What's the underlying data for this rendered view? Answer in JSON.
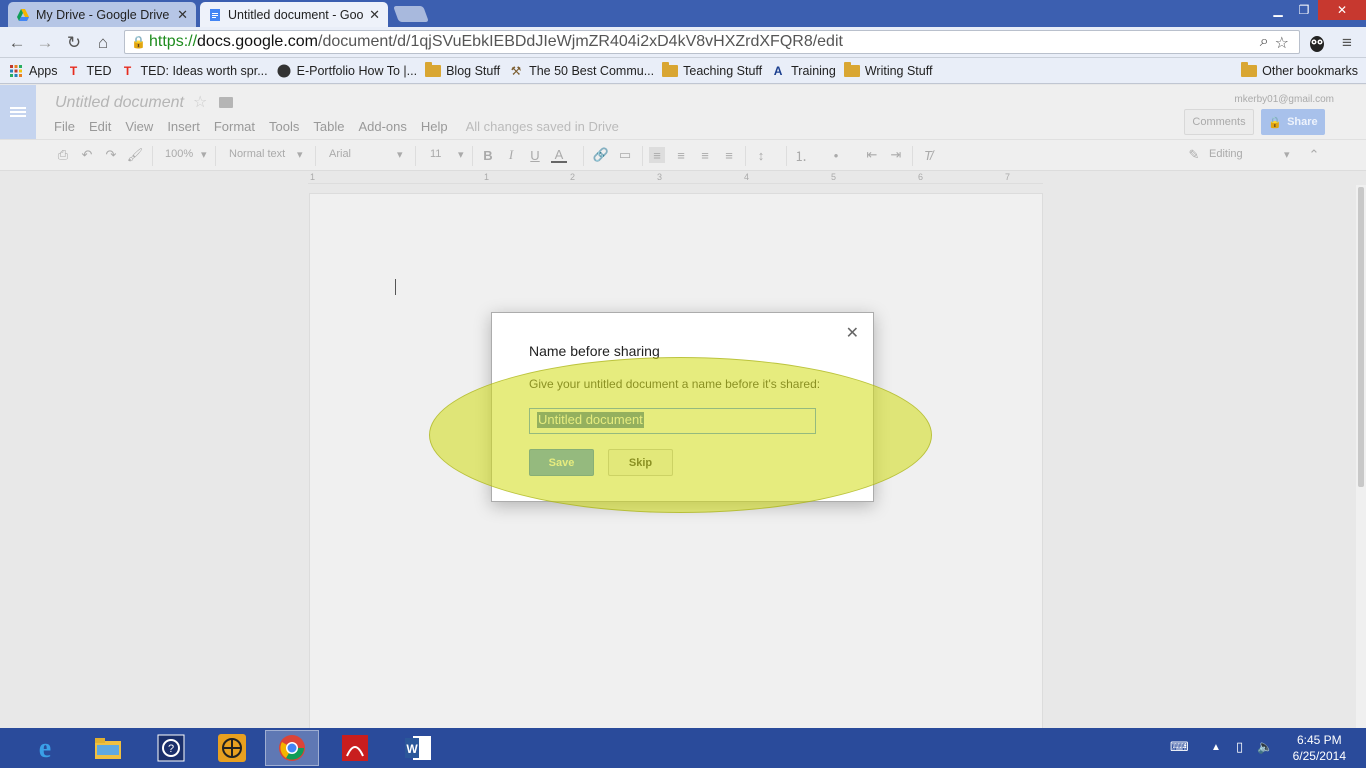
{
  "browser": {
    "tabs": [
      {
        "label": "My Drive - Google Drive",
        "active": false
      },
      {
        "label": "Untitled document - Goog",
        "active": true
      }
    ],
    "url": {
      "scheme": "https://",
      "host": "docs.google.com",
      "path": "/document/d/1qjSVuEbkIEBDdJIeWjmZR404i2xD4kV8vHXZrdXFQR8/edit"
    },
    "bookmarks": [
      {
        "label": "Apps",
        "icon": "apps-grid-icon"
      },
      {
        "label": "TED",
        "icon": "ted-icon"
      },
      {
        "label": "TED: Ideas worth spr...",
        "icon": "ted-icon"
      },
      {
        "label": "E-Portfolio How To |...",
        "icon": "site-icon"
      },
      {
        "label": "Blog Stuff",
        "icon": "folder-icon"
      },
      {
        "label": "The 50 Best Commu...",
        "icon": "site-icon"
      },
      {
        "label": "Teaching Stuff",
        "icon": "folder-icon"
      },
      {
        "label": "Training",
        "icon": "site-icon"
      },
      {
        "label": "Writing Stuff",
        "icon": "folder-icon"
      }
    ],
    "other_bookmarks": "Other bookmarks"
  },
  "docs": {
    "title": "Untitled document",
    "menu": [
      "File",
      "Edit",
      "View",
      "Insert",
      "Format",
      "Tools",
      "Table",
      "Add-ons",
      "Help"
    ],
    "save_status": "All changes saved in Drive",
    "account": "mkerby01@gmail.com",
    "comments_label": "Comments",
    "share_label": "Share",
    "toolbar": {
      "zoom": "100%",
      "style": "Normal text",
      "font": "Arial",
      "size": "11",
      "mode": "Editing"
    },
    "ruler_numbers": [
      "1",
      "1",
      "2",
      "3",
      "4",
      "5",
      "6",
      "7"
    ]
  },
  "dialog": {
    "title": "Name before sharing",
    "description": "Give your untitled document a name before it's shared:",
    "input_value": "Untitled document",
    "save_label": "Save",
    "skip_label": "Skip",
    "close_glyph": "✕"
  },
  "taskbar": {
    "time": "6:45 PM",
    "date": "6/25/2014"
  },
  "colors": {
    "accent_blue": "#4d90fe",
    "highlight": "#d2dc14",
    "taskbar": "#2a4b9b"
  }
}
